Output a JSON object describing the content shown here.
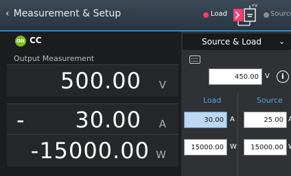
{
  "header": {
    "title": "Measurement & Setup",
    "mode_load": "Load",
    "mode_source": "Source",
    "active_mode_color": "#ff3a6e",
    "symbol_label": "+V"
  },
  "status": {
    "on_badge": "ON",
    "mode": "CC"
  },
  "measurement": {
    "title": "Output Measurement",
    "rows": [
      {
        "sign": "",
        "value": "500.00",
        "unit": "V"
      },
      {
        "sign": "-",
        "value": "30.00",
        "unit": "A"
      },
      {
        "sign": "",
        "value": "-15000.00",
        "unit": "W"
      }
    ]
  },
  "setup": {
    "dropdown": "Source & Load",
    "voltage_value": "450.00",
    "voltage_unit": "V",
    "col_load": "Load",
    "col_source": "Source",
    "load_current": "30.00",
    "source_current": "25.00",
    "current_unit": "A",
    "load_power": "15000.00",
    "source_power": "15000.00",
    "power_unit": "W"
  }
}
